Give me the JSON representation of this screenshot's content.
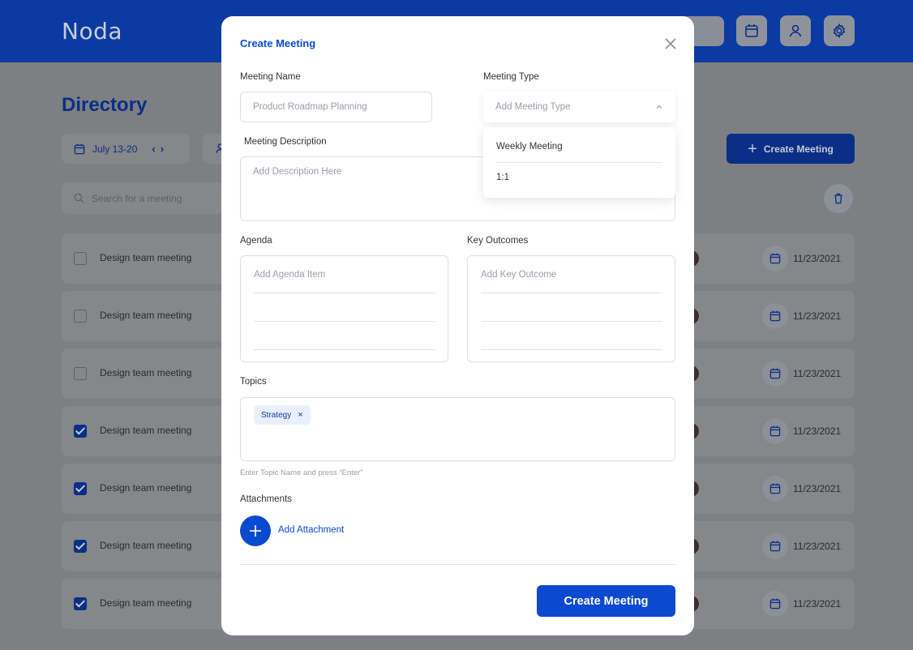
{
  "app": {
    "logo": "Noda"
  },
  "directory": {
    "title": "Directory",
    "date_range": "July 13-20",
    "prev": "‹",
    "next": "›",
    "create_button": "Create Meeting",
    "search_placeholder": "Search for a meeting",
    "rows": [
      {
        "name": "Design team meeting",
        "date": "11/23/2021",
        "checked": false
      },
      {
        "name": "Design team meeting",
        "date": "11/23/2021",
        "checked": false
      },
      {
        "name": "Design team meeting",
        "date": "11/23/2021",
        "checked": false
      },
      {
        "name": "Design team meeting",
        "date": "11/23/2021",
        "checked": true
      },
      {
        "name": "Design team meeting",
        "date": "11/23/2021",
        "checked": true
      },
      {
        "name": "Design team meeting",
        "date": "11/23/2021",
        "checked": true
      },
      {
        "name": "Design team meeting",
        "date": "11/23/2021",
        "checked": true
      }
    ]
  },
  "modal": {
    "title": "Create Meeting",
    "meeting_name": {
      "label": "Meeting Name",
      "placeholder": "Product Roadmap Planning"
    },
    "meeting_type": {
      "label": "Meeting Type",
      "placeholder": "Add Meeting Type",
      "options": [
        "Weekly Meeting",
        "1:1"
      ]
    },
    "description": {
      "label": "Meeting Description",
      "placeholder": "Add Description Here"
    },
    "agenda": {
      "label": "Agenda",
      "placeholder": "Add Agenda Item"
    },
    "outcomes": {
      "label": "Key Outcomes",
      "placeholder": "Add Key Outcome"
    },
    "topics": {
      "label": "Topics",
      "chips": [
        "Strategy"
      ],
      "remove_glyph": "×",
      "hint": "Enter Topic Name and press “Enter”"
    },
    "attachments": {
      "label": "Attachments",
      "add_label": "Add Attachment"
    },
    "submit_label": "Create Meeting"
  },
  "colors": {
    "primary": "#0b4ad0",
    "header": "#0b3aa3",
    "overlay": "#7d7f82"
  }
}
